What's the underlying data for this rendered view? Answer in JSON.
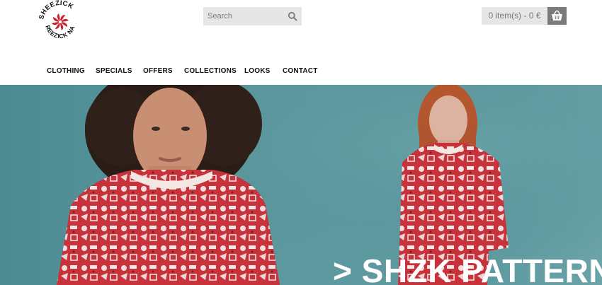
{
  "brand": {
    "logo_text": "SHEEZICK NA REEZICK",
    "accent_color": "#cc1f2f"
  },
  "search": {
    "placeholder": "Search",
    "icon": "search-icon"
  },
  "cart": {
    "summary": "0 item(s) - 0 €",
    "icon": "basket-icon"
  },
  "nav": {
    "items": [
      {
        "label": "CLOTHING"
      },
      {
        "label": "SPECIALS"
      },
      {
        "label": "OFFERS"
      },
      {
        "label": "COLLECTIONS"
      },
      {
        "label": "LOOKS"
      },
      {
        "label": "CONTACT"
      }
    ]
  },
  "hero": {
    "title": "> SHZK PATTERN",
    "background_color": "#5d999f",
    "garment_color": "#c8323a"
  }
}
